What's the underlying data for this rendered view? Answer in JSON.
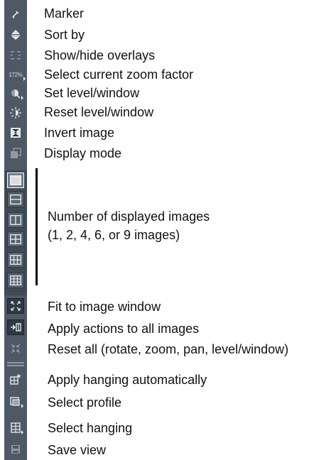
{
  "toolbar": {
    "zoom_icon_text": "172%",
    "items": [
      {
        "label": "Marker",
        "icon": "marker-icon"
      },
      {
        "label": "Sort by",
        "icon": "sort-icon"
      },
      {
        "label": "Show/hide overlays",
        "icon": "overlays-icon"
      },
      {
        "label": "Select current zoom factor",
        "icon": "zoom-factor-icon"
      },
      {
        "label": "Set level/window",
        "icon": "level-window-icon"
      },
      {
        "label": "Reset level/window",
        "icon": "reset-level-window-icon"
      },
      {
        "label": "Invert image",
        "icon": "invert-image-icon"
      },
      {
        "label": "Display mode",
        "icon": "display-mode-icon"
      }
    ],
    "layouts": {
      "description_line1": "Number of displayed images",
      "description_line2": "(1, 2, 4, 6, or 9 images)",
      "options": [
        1,
        2,
        4,
        6,
        9
      ],
      "active": 1
    },
    "actions": [
      {
        "label": "Fit to image window",
        "icon": "fit-window-icon"
      },
      {
        "label": "Apply actions to all images",
        "icon": "apply-all-icon"
      },
      {
        "label": "Reset all (rotate, zoom, pan, level/window)",
        "icon": "reset-all-icon"
      },
      {
        "label": "Apply hanging automatically",
        "icon": "auto-hanging-icon"
      },
      {
        "label": "Select profile",
        "icon": "select-profile-icon"
      },
      {
        "label": "Select hanging",
        "icon": "select-hanging-icon"
      },
      {
        "label": "Save view",
        "icon": "save-view-icon"
      }
    ]
  },
  "colors": {
    "toolbar_bg": "#4d5a66",
    "icon": "#e6e6e6",
    "text": "#111111"
  }
}
